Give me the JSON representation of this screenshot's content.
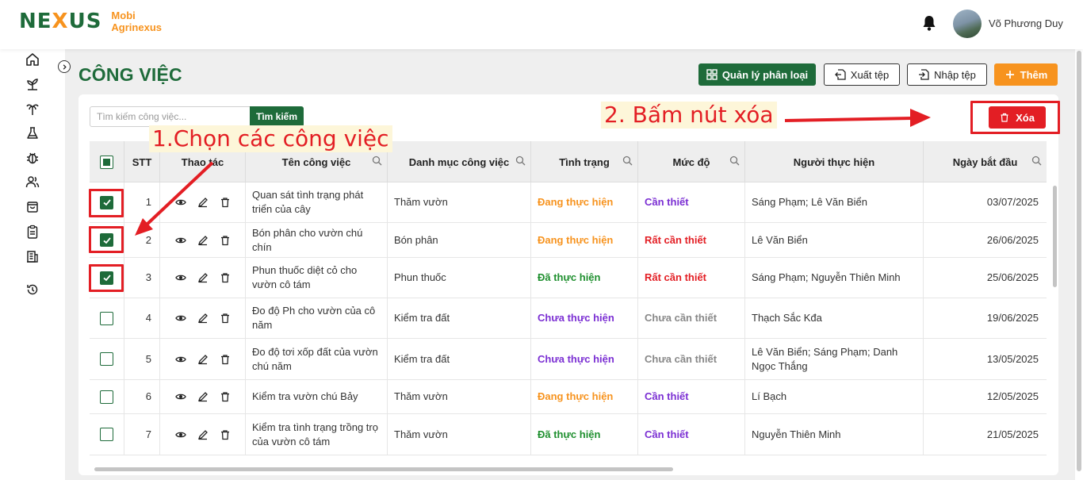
{
  "header": {
    "logo_mark_left": "NE",
    "logo_mark_x": "X",
    "logo_mark_right": "US",
    "brand_line1": "Mobi",
    "brand_line2": "Agrinexus",
    "user_name": "Võ Phương Duy"
  },
  "sidebar": {
    "items": [
      "home-icon",
      "plant-icon",
      "palm-tree-icon",
      "flask-icon",
      "bug-icon",
      "users-icon",
      "bag-icon",
      "clipboard-icon",
      "building-icon",
      "history-icon"
    ]
  },
  "page": {
    "title": "CÔNG VIỆC",
    "btn_manage": "Quản lý phân loại",
    "btn_export": "Xuất tệp",
    "btn_import": "Nhập tệp",
    "btn_add": "Thêm",
    "btn_delete": "Xóa"
  },
  "search": {
    "placeholder": "Tìm kiếm công việc...",
    "button": "Tìm kiếm"
  },
  "table": {
    "headers": {
      "stt": "STT",
      "actions": "Thao tác",
      "name": "Tên công việc",
      "category": "Danh mục công việc",
      "status": "Tình trạng",
      "level": "Mức độ",
      "assignee": "Người thực hiện",
      "start": "Ngày bắt đầu"
    },
    "rows": [
      {
        "checked": true,
        "stt": "1",
        "name": "Quan sát tình trạng phát triển của cây",
        "category": "Thăm vườn",
        "status": "Đang thực hiện",
        "status_kind": "doing",
        "level": "Cần thiết",
        "level_kind": "need",
        "assignee": "Sáng Phạm; Lê  Văn Biển",
        "start": "03/07/2025"
      },
      {
        "checked": true,
        "stt": "2",
        "name": "Bón phân cho vườn chú chín",
        "category": "Bón phân",
        "status": "Đang thực hiện",
        "status_kind": "doing",
        "level": "Rất cần thiết",
        "level_kind": "very",
        "assignee": "Lê  Văn Biển",
        "start": "26/06/2025"
      },
      {
        "checked": true,
        "stt": "3",
        "name": "Phun thuốc diệt cỏ cho vườn cô tám",
        "category": "Phun thuốc",
        "status": "Đã thực hiện",
        "status_kind": "done",
        "level": "Rất cần thiết",
        "level_kind": "very",
        "assignee": "Sáng Phạm; Nguyễn  Thiên Minh",
        "start": "25/06/2025"
      },
      {
        "checked": false,
        "stt": "4",
        "name": "Đo độ Ph cho vườn của cô năm",
        "category": "Kiểm tra đất",
        "status": "Chưa thực hiện",
        "status_kind": "todo",
        "level": "Chưa cần thiết",
        "level_kind": "not",
        "assignee": "Thạch Sắc Kđa",
        "start": "19/06/2025"
      },
      {
        "checked": false,
        "stt": "5",
        "name": "Đo độ tơi xốp đất của vườn chú năm",
        "category": "Kiểm tra đất",
        "status": "Chưa thực hiện",
        "status_kind": "todo",
        "level": "Chưa cần thiết",
        "level_kind": "not",
        "assignee": "Lê  Văn Biển; Sáng Phạm; Danh  Ngọc Thắng",
        "start": "13/05/2025"
      },
      {
        "checked": false,
        "stt": "6",
        "name": "Kiểm tra vườn chú Bảy",
        "category": "Thăm vườn",
        "status": "Đang thực hiện",
        "status_kind": "doing",
        "level": "Cần thiết",
        "level_kind": "need",
        "assignee": "Lí  Bạch",
        "start": "12/05/2025"
      },
      {
        "checked": false,
        "stt": "7",
        "name": "Kiểm tra tình trạng trồng trọ của vườn cô tám",
        "category": "Thăm vườn",
        "status": "Đã thực hiện",
        "status_kind": "done",
        "level": "Cần thiết",
        "level_kind": "need",
        "assignee": "Nguyễn  Thiên Minh",
        "start": "21/05/2025"
      }
    ]
  },
  "annotations": {
    "step1": "1.Chọn các công việc",
    "step2": "2. Bấm nút xóa"
  },
  "colors": {
    "brand_green": "#1e6b3a",
    "brand_orange": "#f7931e",
    "delete_red": "#e31e24",
    "status_doing": "#f7931e",
    "status_done": "#1e8f2e",
    "status_todo": "#7b2fd3"
  }
}
